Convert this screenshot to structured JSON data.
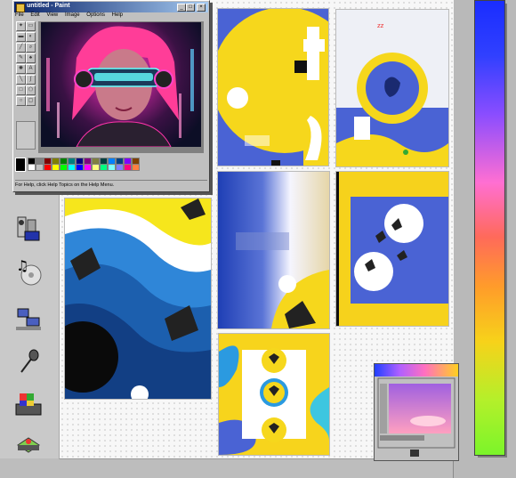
{
  "paint": {
    "title": "untitled - Paint",
    "menu": [
      "File",
      "Edit",
      "View",
      "Image",
      "Options",
      "Help"
    ],
    "status": "For Help, click Help Topics on the Help Menu.",
    "minimize": "_",
    "maximize": "□",
    "close": "×"
  },
  "art2": {
    "caption": "zz"
  },
  "desktop_icons": [
    "media-player-icon",
    "cd-audio-icon",
    "network-icon",
    "microphone-icon",
    "multimedia-icon",
    "cd-drive-icon"
  ],
  "colors": {
    "accent_blue": "#4a63d4",
    "accent_yellow": "#f6e61c",
    "titlebar": "#0a246a"
  }
}
